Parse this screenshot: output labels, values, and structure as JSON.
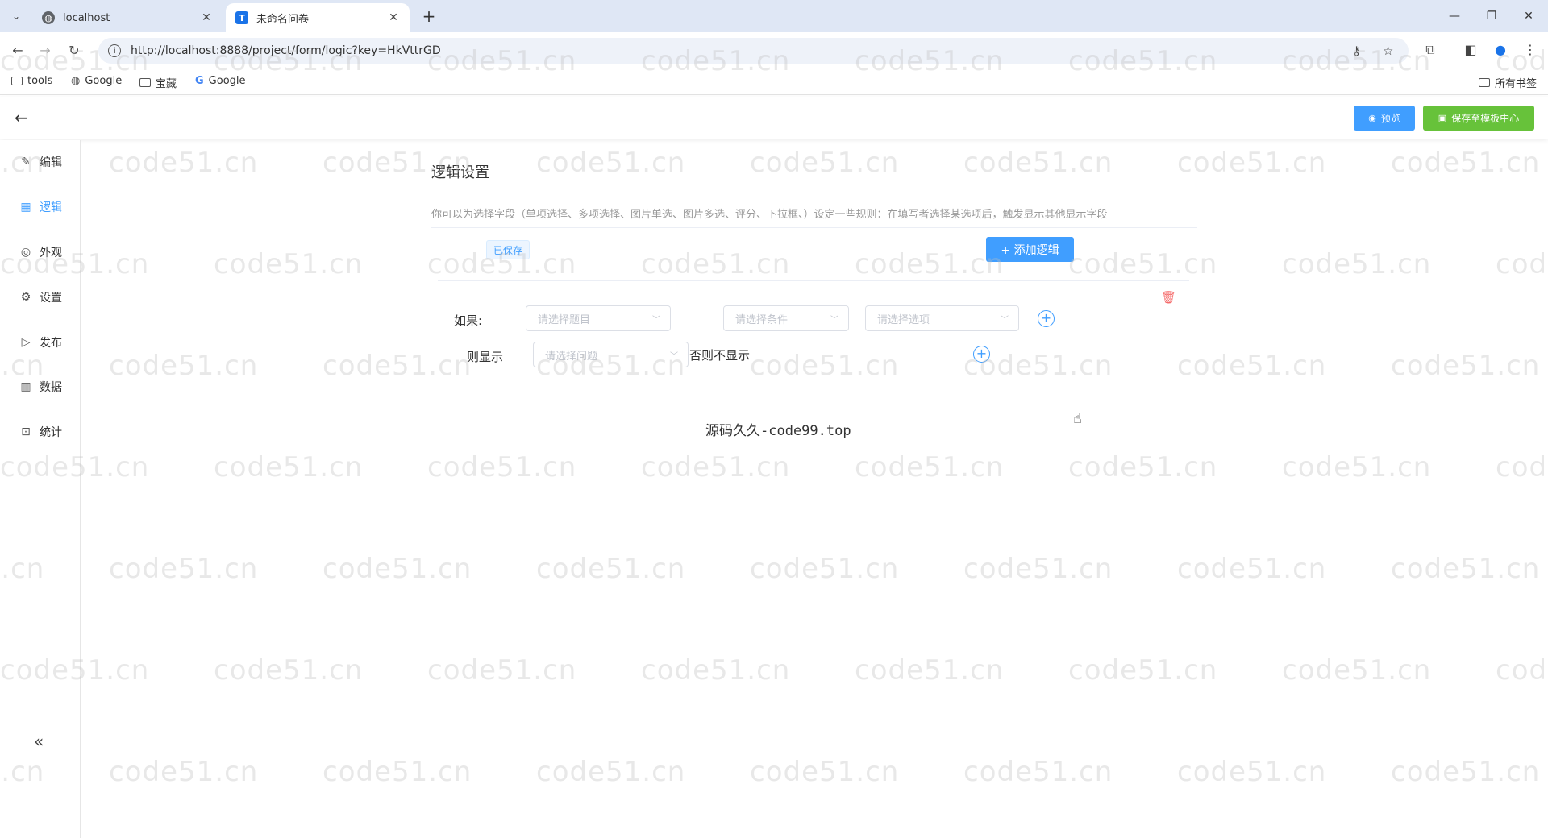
{
  "browser": {
    "tabs": [
      {
        "title": "localhost",
        "favicon": "globe-icon"
      },
      {
        "title": "未命名问卷",
        "favicon": "T"
      }
    ],
    "url": "http://localhost:8888/project/form/logic?key=HkVttrGD",
    "bookmarks": [
      "tools",
      "Google",
      "宝藏",
      "Google"
    ],
    "all_bookmarks": "所有书签"
  },
  "header": {
    "preview_label": "预览",
    "save_template_label": "保存至模板中心"
  },
  "sidebar": {
    "items": [
      {
        "label": "编辑",
        "icon": "edit-icon"
      },
      {
        "label": "逻辑",
        "icon": "grid-icon",
        "active": true
      },
      {
        "label": "外观",
        "icon": "eye-icon"
      },
      {
        "label": "设置",
        "icon": "gear-icon"
      },
      {
        "label": "发布",
        "icon": "play-icon"
      },
      {
        "label": "数据",
        "icon": "bar-chart-icon"
      },
      {
        "label": "统计",
        "icon": "stats-icon"
      }
    ],
    "collapse": "«"
  },
  "main": {
    "title": "逻辑设置",
    "description": "你可以为选择字段（单项选择、多项选择、图片单选、图片多选、评分、下拉框、）设定一些规则：在填写者选择某选项后，触发显示其他显示字段",
    "saved_tag": "已保存",
    "add_logic_label": "+ 添加逻辑",
    "rule": {
      "if_label": "如果:",
      "question_placeholder": "请选择题目",
      "condition_placeholder": "请选择条件",
      "option_placeholder": "请选择选项",
      "then_label": "则显示",
      "show_question_placeholder": "请选择问题",
      "else_label": "否则不显示"
    }
  },
  "footer_text": "源码久久-code99.top",
  "watermark": "code51.cn",
  "colors": {
    "primary": "#409eff",
    "success": "#67c23a",
    "danger": "#f56c6c"
  }
}
